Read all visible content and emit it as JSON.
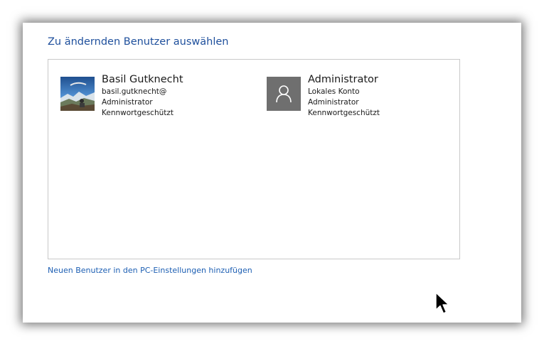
{
  "heading": "Zu ändernden Benutzer auswählen",
  "accounts": [
    {
      "name": "Basil Gutknecht",
      "lines": [
        "basil.gutknecht@",
        "Administrator",
        "Kennwortgeschützt"
      ],
      "picture": "user-photo"
    },
    {
      "name": "Administrator",
      "lines": [
        "Lokales Konto",
        "Administrator",
        "Kennwortgeschützt"
      ],
      "picture": "default-user-icon"
    }
  ],
  "add_user_link": "Neuen Benutzer in den PC-Einstellungen hinzufügen",
  "colors": {
    "heading": "#1e4f9c",
    "link": "#1d5fb3",
    "default_avatar_bg": "#6f6f6f"
  }
}
